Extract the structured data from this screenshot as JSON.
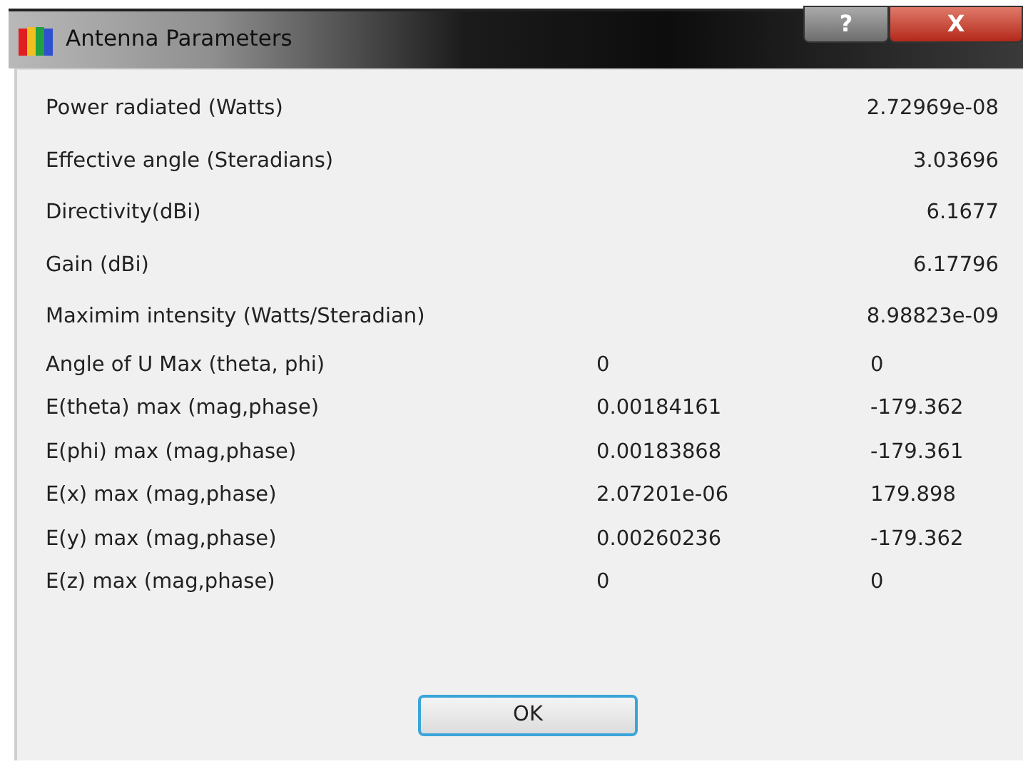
{
  "window": {
    "title": "Antenna Parameters",
    "caption_buttons": [
      {
        "kind": "help",
        "label": "?"
      },
      {
        "kind": "close",
        "label": "X"
      }
    ]
  },
  "rows": [
    {
      "kind": "single",
      "label": "Power radiated (Watts)",
      "value": "2.72969e-08"
    },
    {
      "kind": "single",
      "label": "Effective angle (Steradians)",
      "value": "3.03696"
    },
    {
      "kind": "single",
      "label": "Directivity(dBi)",
      "value": "6.1677"
    },
    {
      "kind": "single",
      "label": "Gain (dBi)",
      "value": "6.17796"
    },
    {
      "kind": "single",
      "label": "Maximim intensity (Watts/Steradian)",
      "value": "8.98823e-09"
    },
    {
      "kind": "pair",
      "label": "Angle of U Max (theta, phi)",
      "values": [
        "0",
        "0"
      ]
    },
    {
      "kind": "pair",
      "label": "E(theta) max (mag,phase)",
      "values": [
        "0.00184161",
        "-179.362"
      ]
    },
    {
      "kind": "pair",
      "label": "E(phi) max (mag,phase)",
      "values": [
        "0.00183868",
        "-179.361"
      ]
    },
    {
      "kind": "pair",
      "label": "E(x) max (mag,phase)",
      "values": [
        "2.07201e-06",
        "179.898"
      ]
    },
    {
      "kind": "pair",
      "label": "E(y) max (mag,phase)",
      "values": [
        "0.00260236",
        "-179.362"
      ]
    },
    {
      "kind": "pair",
      "label": "E(z) max (mag,phase)",
      "values": [
        "0",
        "0"
      ]
    }
  ],
  "buttons": [
    "OK"
  ]
}
